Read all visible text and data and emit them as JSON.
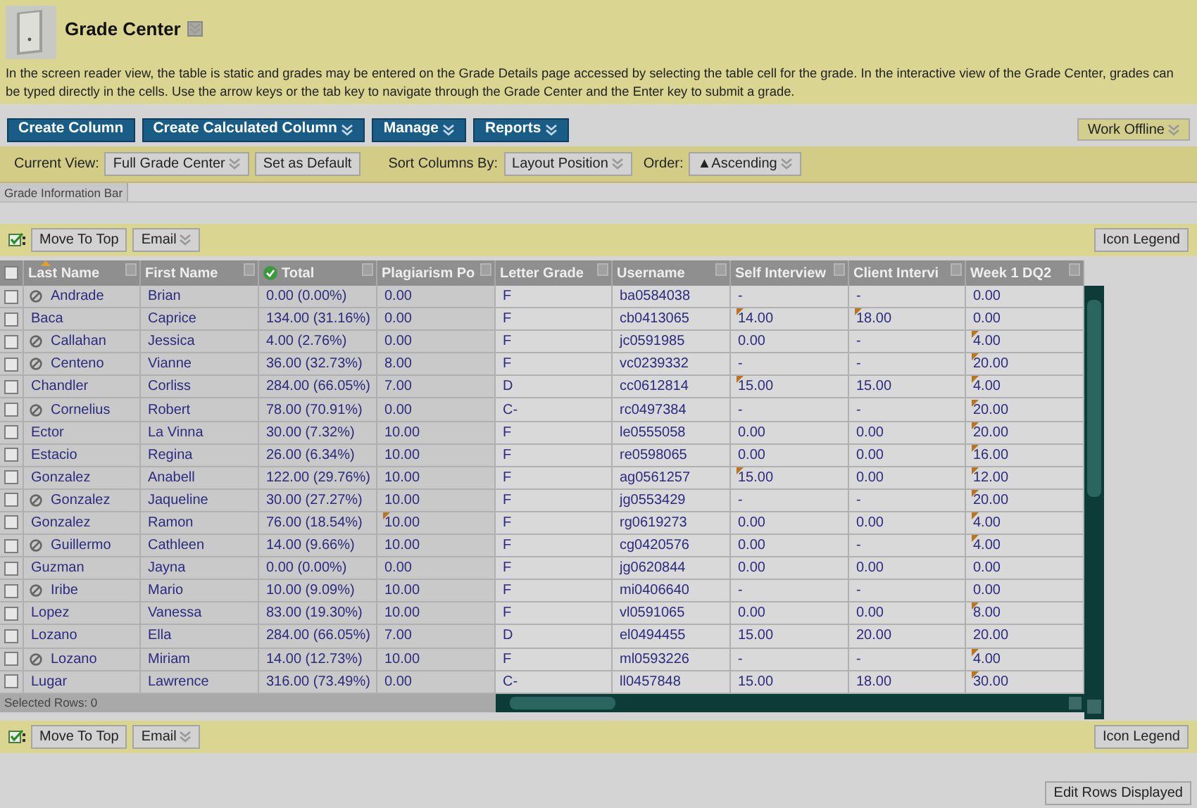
{
  "page": {
    "title": "Grade Center",
    "description": "In the screen reader view, the table is static and grades may be entered on the Grade Details page accessed by selecting the table cell for the grade. In the interactive view of the Grade Center, grades can be typed directly in the cells. Use the arrow keys or the tab key to navigate through the Grade Center and the Enter key to submit a grade."
  },
  "action_bar": {
    "buttons": [
      {
        "label": "Create Column",
        "menu": false
      },
      {
        "label": "Create Calculated Column",
        "menu": true
      },
      {
        "label": "Manage",
        "menu": true
      },
      {
        "label": "Reports",
        "menu": true
      }
    ],
    "work_offline": {
      "label": "Work Offline",
      "menu": true
    }
  },
  "view_bar": {
    "current_view_label": "Current View:",
    "current_view": "Full Grade Center",
    "set_default": "Set as Default",
    "sort_label": "Sort Columns By:",
    "sort_by": "Layout Position",
    "order_label": "Order:",
    "order": "▲Ascending"
  },
  "info_tab": "Grade Information Bar",
  "top_toolbar": {
    "move_to_top": "Move To Top",
    "email": "Email",
    "icon_legend": "Icon Legend"
  },
  "table": {
    "header_selected": false,
    "columns": [
      {
        "label": "Last Name",
        "sorted": true,
        "kind": "text"
      },
      {
        "label": "First Name",
        "sorted": false,
        "kind": "text"
      },
      {
        "label": "Total",
        "sorted": false,
        "kind": "total"
      },
      {
        "label": "Plagiarism Po",
        "sorted": false,
        "kind": "text"
      },
      {
        "label": "Letter Grade",
        "sorted": false,
        "kind": "text"
      },
      {
        "label": "Username",
        "sorted": false,
        "kind": "text"
      },
      {
        "label": "Self Interview",
        "sorted": false,
        "kind": "text"
      },
      {
        "label": "Client Intervi",
        "sorted": false,
        "kind": "text"
      },
      {
        "label": "Week 1 DQ2",
        "sorted": false,
        "kind": "text"
      }
    ],
    "rows": [
      {
        "selected": false,
        "unavailable": true,
        "last_name": "Andrade",
        "first_name": "Brian",
        "total": "0.00 (0.00%)",
        "letter": "F",
        "username": "ba0584038",
        "scores": [
          {
            "text": "0.00",
            "flagged": false
          },
          {
            "text": "-",
            "flagged": false
          },
          {
            "text": "-",
            "flagged": false
          },
          {
            "text": "0.00",
            "flagged": false
          }
        ]
      },
      {
        "selected": false,
        "unavailable": false,
        "last_name": "Baca",
        "first_name": "Caprice",
        "total": "134.00 (31.16%)",
        "letter": "F",
        "username": "cb0413065",
        "scores": [
          {
            "text": "0.00",
            "flagged": false
          },
          {
            "text": "14.00",
            "flagged": true
          },
          {
            "text": "18.00",
            "flagged": true
          },
          {
            "text": "0.00",
            "flagged": false
          }
        ]
      },
      {
        "selected": false,
        "unavailable": true,
        "last_name": "Callahan",
        "first_name": "Jessica",
        "total": "4.00 (2.76%)",
        "letter": "F",
        "username": "jc0591985",
        "scores": [
          {
            "text": "0.00",
            "flagged": false
          },
          {
            "text": "0.00",
            "flagged": false
          },
          {
            "text": "-",
            "flagged": false
          },
          {
            "text": "4.00",
            "flagged": true
          }
        ]
      },
      {
        "selected": false,
        "unavailable": true,
        "last_name": "Centeno",
        "first_name": "Vianne",
        "total": "36.00 (32.73%)",
        "letter": "F",
        "username": "vc0239332",
        "scores": [
          {
            "text": "8.00",
            "flagged": false
          },
          {
            "text": "-",
            "flagged": false
          },
          {
            "text": "-",
            "flagged": false
          },
          {
            "text": "20.00",
            "flagged": true
          }
        ]
      },
      {
        "selected": false,
        "unavailable": false,
        "last_name": "Chandler",
        "first_name": "Corliss",
        "total": "284.00 (66.05%)",
        "letter": "D",
        "username": "cc0612814",
        "scores": [
          {
            "text": "7.00",
            "flagged": false
          },
          {
            "text": "15.00",
            "flagged": true
          },
          {
            "text": "15.00",
            "flagged": false
          },
          {
            "text": "4.00",
            "flagged": true
          }
        ]
      },
      {
        "selected": false,
        "unavailable": true,
        "last_name": "Cornelius",
        "first_name": "Robert",
        "total": "78.00 (70.91%)",
        "letter": "C-",
        "username": "rc0497384",
        "scores": [
          {
            "text": "0.00",
            "flagged": false
          },
          {
            "text": "-",
            "flagged": false
          },
          {
            "text": "-",
            "flagged": false
          },
          {
            "text": "20.00",
            "flagged": true
          }
        ]
      },
      {
        "selected": false,
        "unavailable": false,
        "last_name": "Ector",
        "first_name": "La Vinna",
        "total": "30.00 (7.32%)",
        "letter": "F",
        "username": "le0555058",
        "scores": [
          {
            "text": "10.00",
            "flagged": false
          },
          {
            "text": "0.00",
            "flagged": false
          },
          {
            "text": "0.00",
            "flagged": false
          },
          {
            "text": "20.00",
            "flagged": true
          }
        ]
      },
      {
        "selected": false,
        "unavailable": false,
        "last_name": "Estacio",
        "first_name": "Regina",
        "total": "26.00 (6.34%)",
        "letter": "F",
        "username": "re0598065",
        "scores": [
          {
            "text": "10.00",
            "flagged": false
          },
          {
            "text": "0.00",
            "flagged": false
          },
          {
            "text": "0.00",
            "flagged": false
          },
          {
            "text": "16.00",
            "flagged": true
          }
        ]
      },
      {
        "selected": false,
        "unavailable": false,
        "last_name": "Gonzalez",
        "first_name": "Anabell",
        "total": "122.00 (29.76%)",
        "letter": "F",
        "username": "ag0561257",
        "scores": [
          {
            "text": "10.00",
            "flagged": false
          },
          {
            "text": "15.00",
            "flagged": true
          },
          {
            "text": "0.00",
            "flagged": false
          },
          {
            "text": "12.00",
            "flagged": true
          }
        ]
      },
      {
        "selected": false,
        "unavailable": true,
        "last_name": "Gonzalez",
        "first_name": "Jaqueline",
        "total": "30.00 (27.27%)",
        "letter": "F",
        "username": "jg0553429",
        "scores": [
          {
            "text": "10.00",
            "flagged": false
          },
          {
            "text": "-",
            "flagged": false
          },
          {
            "text": "-",
            "flagged": false
          },
          {
            "text": "20.00",
            "flagged": true
          }
        ]
      },
      {
        "selected": false,
        "unavailable": false,
        "last_name": "Gonzalez",
        "first_name": "Ramon",
        "total": "76.00 (18.54%)",
        "letter": "F",
        "username": "rg0619273",
        "scores": [
          {
            "text": "10.00",
            "flagged": true
          },
          {
            "text": "0.00",
            "flagged": false
          },
          {
            "text": "0.00",
            "flagged": false
          },
          {
            "text": "4.00",
            "flagged": true
          }
        ]
      },
      {
        "selected": false,
        "unavailable": true,
        "last_name": "Guillermo",
        "first_name": "Cathleen",
        "total": "14.00 (9.66%)",
        "letter": "F",
        "username": "cg0420576",
        "scores": [
          {
            "text": "10.00",
            "flagged": false
          },
          {
            "text": "0.00",
            "flagged": false
          },
          {
            "text": "-",
            "flagged": false
          },
          {
            "text": "4.00",
            "flagged": true
          }
        ]
      },
      {
        "selected": false,
        "unavailable": false,
        "last_name": "Guzman",
        "first_name": "Jayna",
        "total": "0.00 (0.00%)",
        "letter": "F",
        "username": "jg0620844",
        "scores": [
          {
            "text": "0.00",
            "flagged": false
          },
          {
            "text": "0.00",
            "flagged": false
          },
          {
            "text": "0.00",
            "flagged": false
          },
          {
            "text": "0.00",
            "flagged": false
          }
        ]
      },
      {
        "selected": false,
        "unavailable": true,
        "last_name": "Iribe",
        "first_name": "Mario",
        "total": "10.00 (9.09%)",
        "letter": "F",
        "username": "mi0406640",
        "scores": [
          {
            "text": "10.00",
            "flagged": false
          },
          {
            "text": "-",
            "flagged": false
          },
          {
            "text": "-",
            "flagged": false
          },
          {
            "text": "0.00",
            "flagged": false
          }
        ]
      },
      {
        "selected": false,
        "unavailable": false,
        "last_name": "Lopez",
        "first_name": "Vanessa",
        "total": "83.00 (19.30%)",
        "letter": "F",
        "username": "vl0591065",
        "scores": [
          {
            "text": "10.00",
            "flagged": false
          },
          {
            "text": "0.00",
            "flagged": false
          },
          {
            "text": "0.00",
            "flagged": false
          },
          {
            "text": "8.00",
            "flagged": true
          }
        ]
      },
      {
        "selected": false,
        "unavailable": false,
        "last_name": "Lozano",
        "first_name": "Ella",
        "total": "284.00 (66.05%)",
        "letter": "D",
        "username": "el0494455",
        "scores": [
          {
            "text": "7.00",
            "flagged": false
          },
          {
            "text": "15.00",
            "flagged": false
          },
          {
            "text": "20.00",
            "flagged": false
          },
          {
            "text": "20.00",
            "flagged": false
          }
        ]
      },
      {
        "selected": false,
        "unavailable": true,
        "last_name": "Lozano",
        "first_name": "Miriam",
        "total": "14.00 (12.73%)",
        "letter": "F",
        "username": "ml0593226",
        "scores": [
          {
            "text": "10.00",
            "flagged": false
          },
          {
            "text": "-",
            "flagged": false
          },
          {
            "text": "-",
            "flagged": false
          },
          {
            "text": "4.00",
            "flagged": true
          }
        ]
      },
      {
        "selected": false,
        "unavailable": false,
        "last_name": "Lugar",
        "first_name": "Lawrence",
        "total": "316.00 (73.49%)",
        "letter": "C-",
        "username": "ll0457848",
        "scores": [
          {
            "text": "0.00",
            "flagged": false
          },
          {
            "text": "15.00",
            "flagged": false
          },
          {
            "text": "18.00",
            "flagged": false
          },
          {
            "text": "30.00",
            "flagged": true
          }
        ]
      }
    ],
    "selected_rows": "Selected Rows: 0"
  },
  "bottom_toolbar": {
    "move_to_top": "Move To Top",
    "email": "Email",
    "icon_legend": "Icon Legend"
  },
  "edit_rows": "Edit Rows Displayed"
}
